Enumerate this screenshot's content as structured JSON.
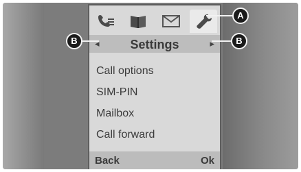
{
  "icons": [
    {
      "name": "phone-call-list-icon"
    },
    {
      "name": "phonebook-icon"
    },
    {
      "name": "message-envelope-icon"
    },
    {
      "name": "settings-wrench-icon",
      "active": true
    }
  ],
  "header": {
    "title": "Settings"
  },
  "menu": {
    "items": [
      "Call options",
      "SIM-PIN",
      "Mailbox",
      "Call forward"
    ]
  },
  "softkeys": {
    "left": "Back",
    "right": "Ok"
  },
  "callouts": {
    "a": "A",
    "b_left": "B",
    "b_right": "B"
  },
  "colors": {
    "screen_bg": "#d9d9d9",
    "bar_bg": "#bdbdbd",
    "text": "#3a3a3a",
    "callout_bg": "#1b1b1b"
  }
}
